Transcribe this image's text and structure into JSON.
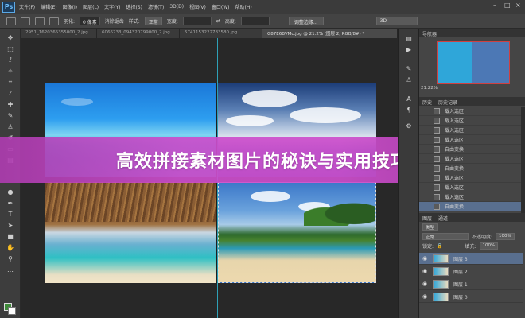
{
  "app": {
    "logo": "Ps",
    "menu": [
      "文件(F)",
      "编辑(E)",
      "图像(I)",
      "图层(L)",
      "文字(Y)",
      "选择(S)",
      "滤镜(T)",
      "3D(D)",
      "视图(V)",
      "窗口(W)",
      "帮助(H)"
    ]
  },
  "options": {
    "feather_label": "羽化:",
    "feather_value": "0 像素",
    "antialias_label": "消除锯齿",
    "style_label": "样式:",
    "style_value": "正常",
    "width_label": "宽度:",
    "height_label": "高度:",
    "refine_edge_button": "调整边缘...",
    "workspace_value": "3D"
  },
  "tabs": [
    {
      "label": "2951_1620365355000_2.jpg",
      "active": false
    },
    {
      "label": "6066733_094320799000_2.jpg",
      "active": false
    },
    {
      "label": "5741153222783580.jpg",
      "active": false
    },
    {
      "label": "G87E6BVMc.jpg @ 21.2% (图层 2, RGB/8#) *",
      "active": true
    }
  ],
  "banner": {
    "title": "高效拼接素材图片的秘诀与实用技巧"
  },
  "navigator": {
    "tab_label": "导航器",
    "zoom": "21.22%"
  },
  "history": {
    "tabs": [
      "历史",
      "历史记录"
    ],
    "items": [
      {
        "label": "载入选区",
        "active": false
      },
      {
        "label": "载入选区",
        "active": false
      },
      {
        "label": "载入选区",
        "active": false
      },
      {
        "label": "载入选区",
        "active": false
      },
      {
        "label": "自由变换",
        "active": false
      },
      {
        "label": "载入选区",
        "active": false
      },
      {
        "label": "自由变换",
        "active": false
      },
      {
        "label": "载入选区",
        "active": false
      },
      {
        "label": "载入选区",
        "active": false
      },
      {
        "label": "载入选区",
        "active": false
      },
      {
        "label": "自由变换",
        "active": true
      }
    ]
  },
  "layers": {
    "tabs": [
      "图层",
      "通道"
    ],
    "filter_label": "类型",
    "blend_mode": "正常",
    "opacity_label": "不透明度:",
    "opacity_value": "100%",
    "lock_label": "锁定:",
    "fill_label": "填充:",
    "fill_value": "100%",
    "items": [
      {
        "label": "图层 3",
        "active": true
      },
      {
        "label": "图层 2",
        "active": false
      },
      {
        "label": "图层 1",
        "active": false
      },
      {
        "label": "图层 0",
        "active": false
      }
    ]
  },
  "colors": {
    "foreground": "#3e8a3a",
    "background": "#ffffff",
    "guide": "#2fb6d0",
    "banner": "#cd4ecc"
  }
}
